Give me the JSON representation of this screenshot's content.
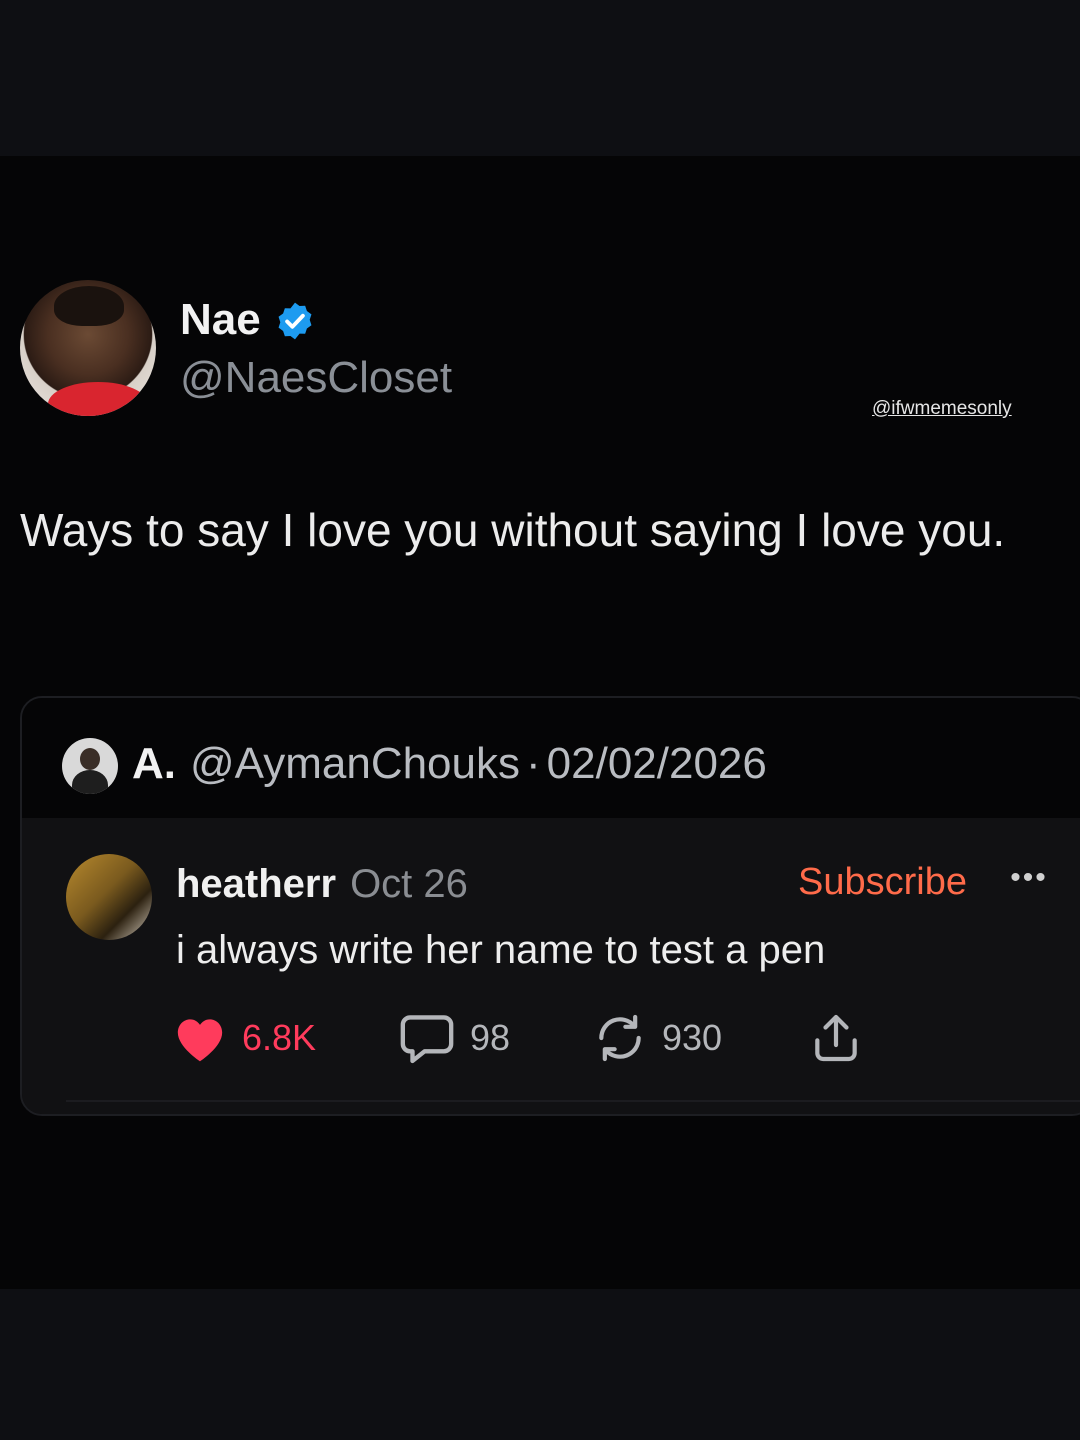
{
  "tweet": {
    "display_name": "Nae",
    "handle": "@NaesCloset",
    "verified": true,
    "text": "Ways to say I love you without saying I love you."
  },
  "watermark": "@ifwmemesonly",
  "quote": {
    "author_name": "A.",
    "author_handle": "@AymanChouks",
    "separator": "·",
    "date": "02/02/2026",
    "reply": {
      "author_name": "heatherr",
      "date": "Oct 26",
      "subscribe_label": "Subscribe",
      "more_label": "•••",
      "text": "i always write her name to test a pen",
      "likes": "6.8K",
      "comments": "98",
      "reposts": "930"
    }
  },
  "icons": [
    "verified-icon",
    "heart-icon",
    "comment-icon",
    "repost-icon",
    "share-icon"
  ],
  "colors": {
    "background": "#050506",
    "verified": "#1d9bf0",
    "like": "#ff3b5c",
    "subscribe": "#ff6b4a"
  }
}
